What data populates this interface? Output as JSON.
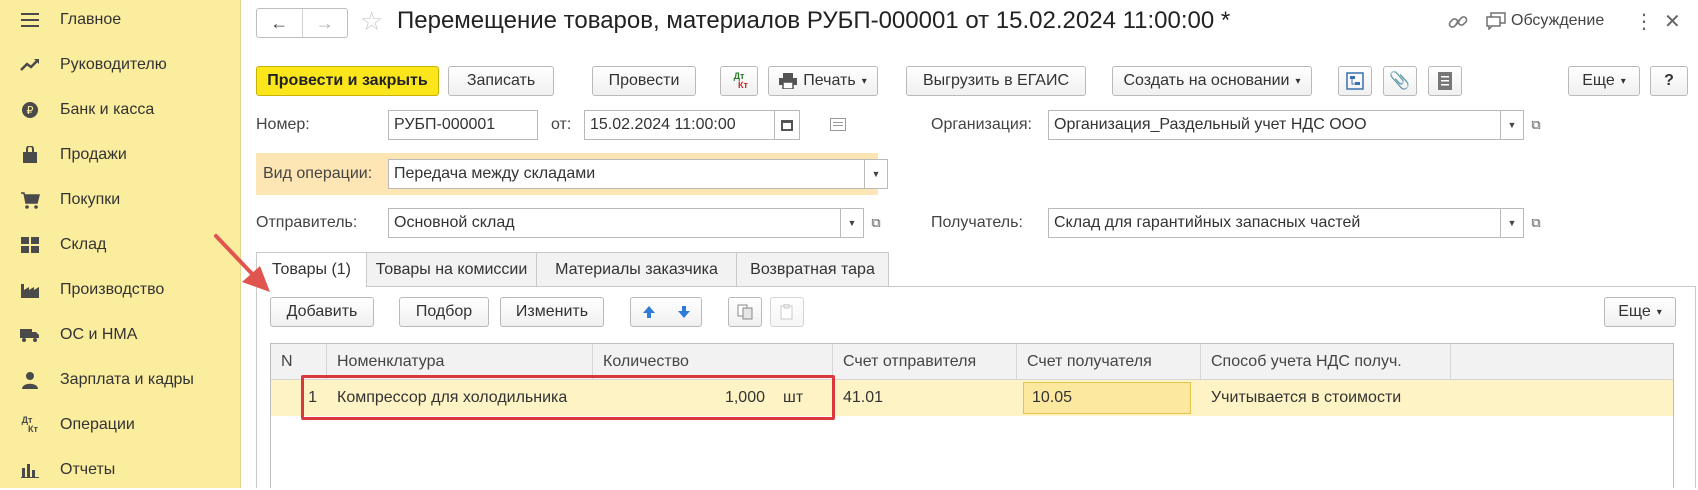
{
  "sidebar": {
    "items": [
      {
        "label": "Главное",
        "icon": "menu-icon"
      },
      {
        "label": "Руководителю",
        "icon": "trend-icon"
      },
      {
        "label": "Банк и касса",
        "icon": "coin-icon"
      },
      {
        "label": "Продажи",
        "icon": "bag-icon"
      },
      {
        "label": "Покупки",
        "icon": "cart-icon"
      },
      {
        "label": "Склад",
        "icon": "warehouse-icon"
      },
      {
        "label": "Производство",
        "icon": "factory-icon"
      },
      {
        "label": "ОС и НМА",
        "icon": "truck-icon"
      },
      {
        "label": "Зарплата и кадры",
        "icon": "person-icon"
      },
      {
        "label": "Операции",
        "icon": "dt-kt-icon"
      },
      {
        "label": "Отчеты",
        "icon": "bar-chart-icon"
      }
    ]
  },
  "header": {
    "back": "←",
    "forward": "→",
    "title": "Перемещение товаров, материалов РУБП-000001 от 15.02.2024 11:00:00 *",
    "discussion_label": "Обсуждение",
    "more": "⋮",
    "close": "✕"
  },
  "toolbar": {
    "post_close": "Провести и закрыть",
    "save": "Записать",
    "post": "Провести",
    "dtkt": "Дт Кт",
    "print": "Печать",
    "egais": "Выгрузить в ЕГАИС",
    "create_based": "Создать на основании",
    "more": "Еще",
    "help": "?"
  },
  "form": {
    "number_label": "Номер:",
    "number_value": "РУБП-000001",
    "from_label": "от:",
    "date_value": "15.02.2024 11:00:00",
    "org_label": "Организация:",
    "org_value": "Организация_Раздельный учет НДС ООО",
    "op_label": "Вид операции:",
    "op_value": "Передача между складами",
    "sender_label": "Отправитель:",
    "sender_value": "Основной склад",
    "receiver_label": "Получатель:",
    "receiver_value": "Склад для гарантийных запасных частей"
  },
  "tabs": [
    "Товары (1)",
    "Товары на комиссии",
    "Материалы заказчика",
    "Возвратная тара"
  ],
  "table_toolbar": {
    "add": "Добавить",
    "pick": "Подбор",
    "change": "Изменить",
    "more": "Еще"
  },
  "table": {
    "columns": [
      "N",
      "Номенклатура",
      "Количество",
      "Счет отправителя",
      "Счет получателя",
      "Способ учета НДС получ."
    ],
    "rows": [
      {
        "n": "1",
        "item": "Компрессор для холодильника",
        "qty": "1,000",
        "unit": "шт",
        "sender_acc": "41.01",
        "receiver_acc": "10.05",
        "vat_method": "Учитывается в стоимости"
      }
    ]
  },
  "colors": {
    "sidebar_bg": "#fbed9e",
    "primary_button": "#fbe61b",
    "highlight_box": "#d9393c",
    "arrow": "#e0554f",
    "selected_row": "#fdf3c4"
  }
}
